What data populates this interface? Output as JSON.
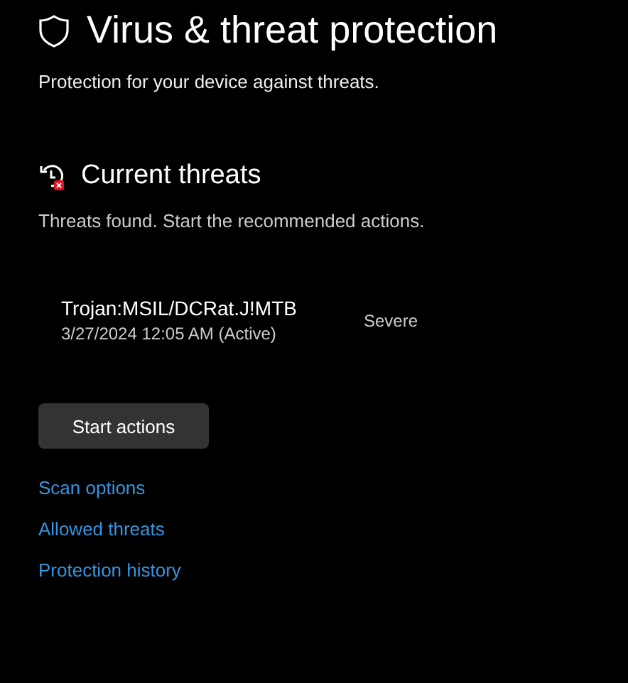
{
  "header": {
    "title": "Virus & threat protection",
    "subtitle": "Protection for your device against threats."
  },
  "current_threats": {
    "heading": "Current threats",
    "description": "Threats found. Start the recommended actions.",
    "threats": [
      {
        "name": "Trojan:MSIL/DCRat.J!MTB",
        "detail": "3/27/2024 12:05 AM (Active)",
        "severity": "Severe"
      }
    ],
    "action_button": "Start actions"
  },
  "links": [
    "Scan options",
    "Allowed threats",
    "Protection history"
  ]
}
